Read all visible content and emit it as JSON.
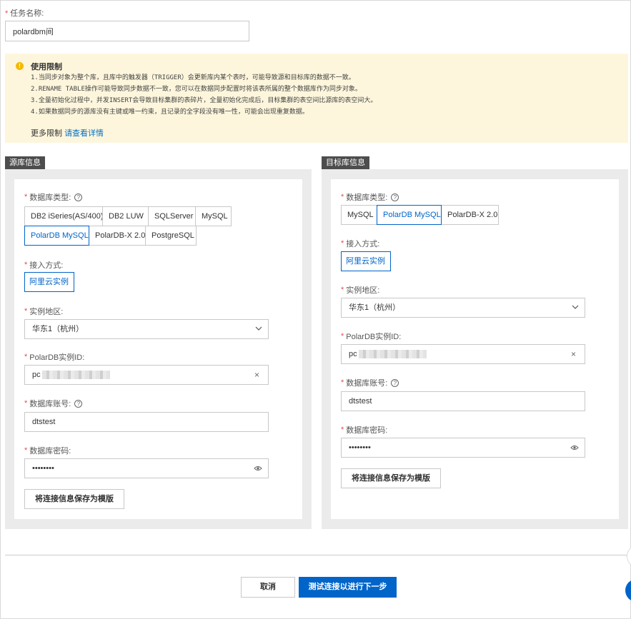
{
  "task": {
    "label": "任务名称:",
    "value": "polardbm间"
  },
  "notice": {
    "title": "使用限制",
    "lines": [
      "1.当同步对象为整个库，且库中的触发器（TRIGGER）会更新库内某个表时，可能导致源和目标库的数据不一致。",
      "2.RENAME TABLE操作可能导致同步数据不一致，您可以在数据同步配置时将该表所属的整个数据库作为同步对象。",
      "3.全量初始化过程中，并发INSERT会导致目标集群的表碎片，全量初始化完成后，目标集群的表空间比源库的表空间大。",
      "4.如果数据同步的源库没有主键或唯一约束，且记录的全字段没有唯一性，可能会出现重复数据。"
    ],
    "more_prefix": "更多限制",
    "more_link": "请查看详情"
  },
  "source": {
    "tag": "源库信息",
    "db_type_label": "数据库类型:",
    "db_types": [
      "DB2 iSeries(AS/400)",
      "DB2 LUW",
      "SQLServer",
      "MySQL",
      "PolarDB MySQL",
      "PolarDB-X 2.0",
      "PostgreSQL"
    ],
    "db_type_selected": "PolarDB MySQL",
    "access_label": "接入方式:",
    "access_value": "阿里云实例",
    "region_label": "实例地区:",
    "region_value": "华东1（杭州）",
    "instance_label": "PolarDB实例ID:",
    "instance_value": "pc",
    "account_label": "数据库账号:",
    "account_value": "dtstest",
    "password_label": "数据库密码:",
    "password_value": "••••••••",
    "template_button": "将连接信息保存为模版"
  },
  "target": {
    "tag": "目标库信息",
    "db_type_label": "数据库类型:",
    "db_types": [
      "MySQL",
      "PolarDB MySQL",
      "PolarDB-X 2.0"
    ],
    "db_type_selected": "PolarDB MySQL",
    "access_label": "接入方式:",
    "access_value": "阿里云实例",
    "region_label": "实例地区:",
    "region_value": "华东1（杭州）",
    "instance_label": "PolarDB实例ID:",
    "instance_value": "pc",
    "account_label": "数据库账号:",
    "account_value": "dtstest",
    "password_label": "数据库密码:",
    "password_value": "••••••••",
    "template_button": "将连接信息保存为模版"
  },
  "footer": {
    "cancel": "取消",
    "next": "测试连接以进行下一步"
  },
  "colors": {
    "primary": "#0064c8",
    "required": "#e34d4d",
    "notice_bg": "#fdf6dc"
  }
}
